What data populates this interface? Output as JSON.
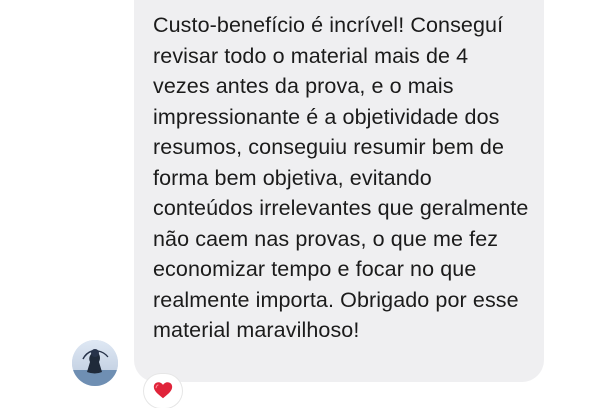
{
  "message": {
    "text": "Custo-benefício é incrível! Conseguí revisar todo o material mais de 4 vezes antes da prova, e o mais impressionante é a objetividade dos resumos, conseguiu resumir bem de forma bem objetiva, evitando conteúdos irrelevantes que geralmente não caem nas provas, o que me fez economizar tempo e focar no que realmente importa. Obrigado por esse material maravilhoso!",
    "reaction_icon": "red-heart-icon"
  },
  "colors": {
    "bubble_background": "#efeff1",
    "text": "#1b1b1b",
    "heart": "#e0243a"
  }
}
